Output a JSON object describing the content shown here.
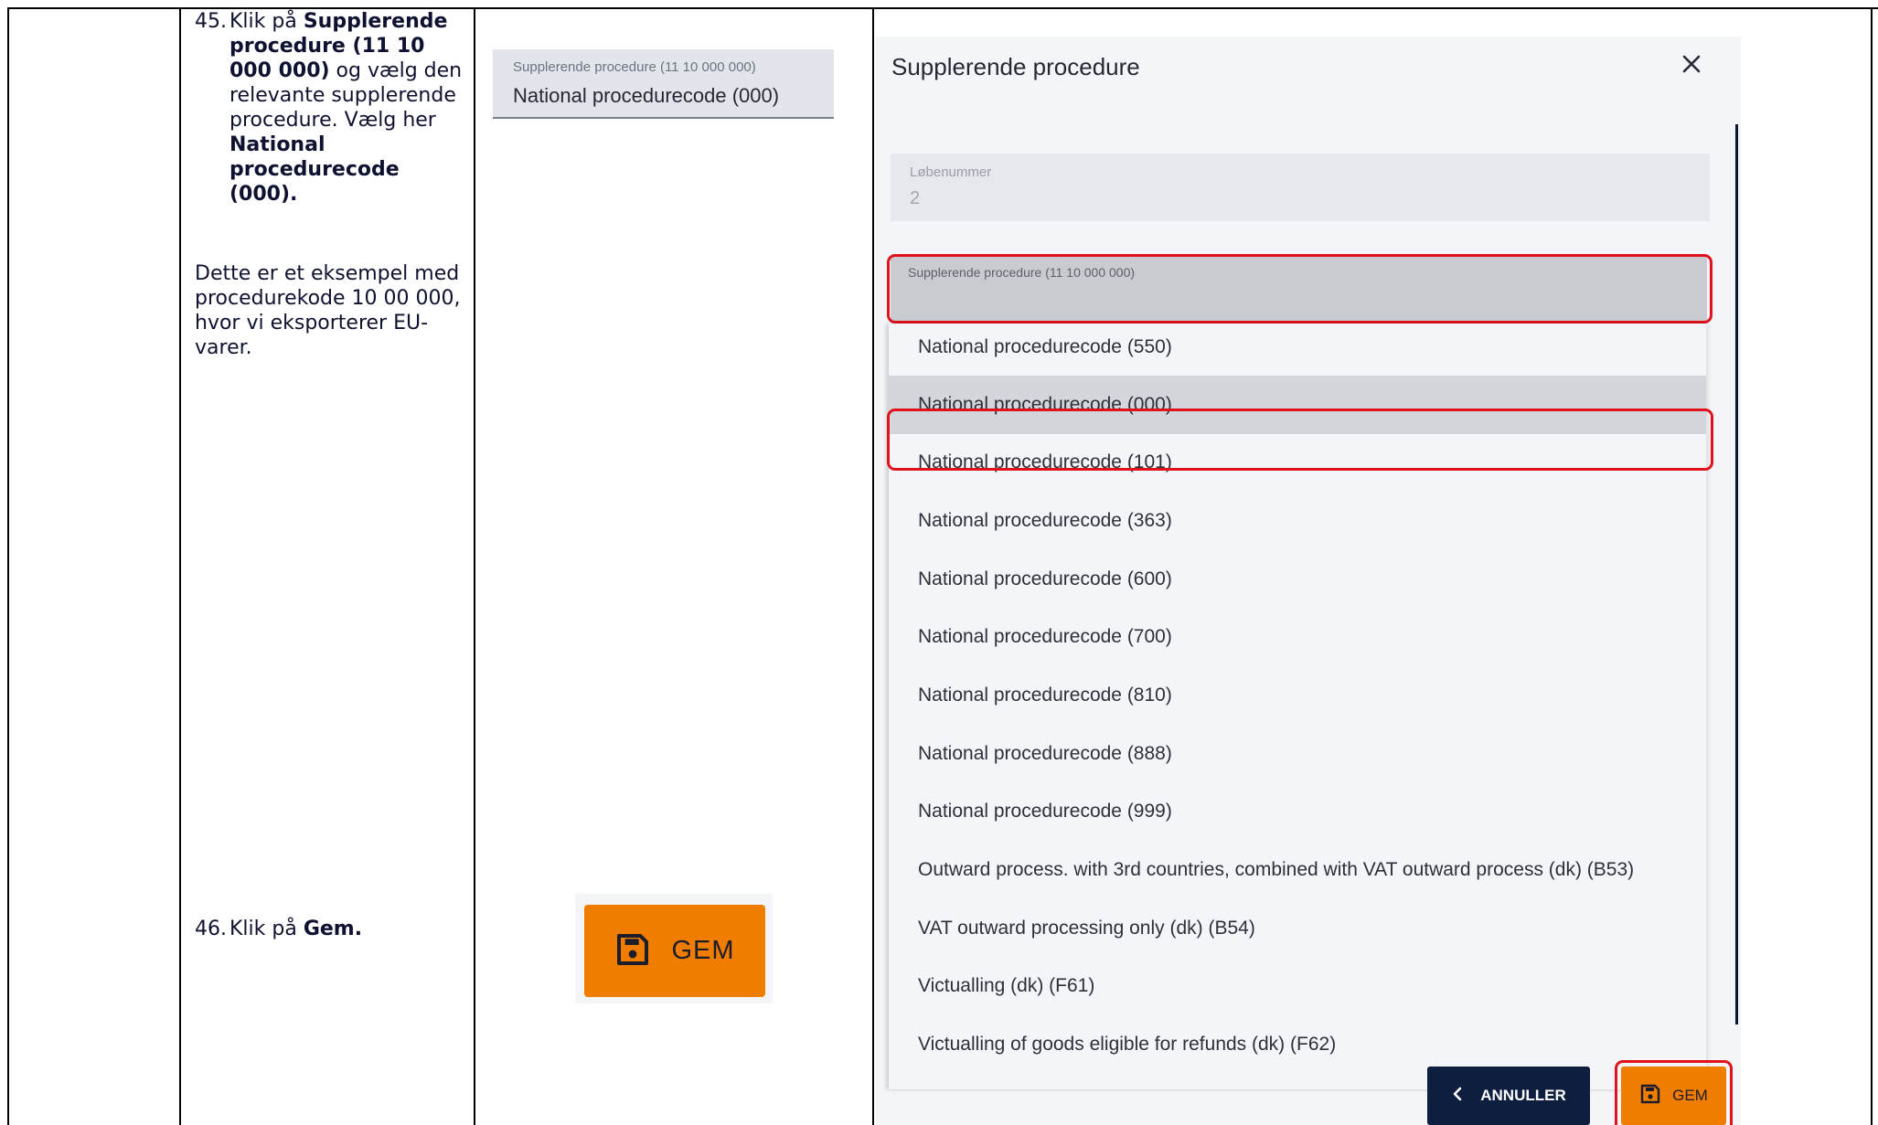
{
  "steps": [
    {
      "number": "45.",
      "lead": "Klik på ",
      "bold1": "Supplerende procedure (11 10 000 000)",
      "mid": " og vælg den relevante supplerende procedure. Vælg her ",
      "bold2": "National procedurecode (000)."
    },
    {
      "number": "46.",
      "lead": "Klik på ",
      "bold1": "Gem."
    }
  ],
  "note": "Dette er et eksempel med procedurekode 10 00 000, hvor vi eksporterer EU-varer.",
  "snippet_field": {
    "label": "Supplerende procedure (11 10 000 000)",
    "value": "National procedurecode (000)"
  },
  "snippet_button": {
    "label": "GEM",
    "icon": "save-icon"
  },
  "dialog": {
    "title": "Supplerende procedure",
    "close_icon": "close-icon",
    "lobenummer": {
      "label": "Løbenummer",
      "value": "2"
    },
    "procedure_field": {
      "label": "Supplerende procedure (11 10 000 000)"
    },
    "options": [
      "National procedurecode (550)",
      "National procedurecode (000)",
      "National procedurecode (101)",
      "National procedurecode (363)",
      "National procedurecode (600)",
      "National procedurecode (700)",
      "National procedurecode (810)",
      "National procedurecode (888)",
      "National procedurecode (999)",
      "Outward process. with 3rd countries, combined with VAT outward process (dk) (B53)",
      "VAT outward processing only (dk) (B54)",
      "Victualling (dk) (F61)",
      "Victualling of goods eligible for refunds (dk) (F62)"
    ],
    "selected_option": "National procedurecode (000)",
    "cancel_label": "ANNULLER",
    "save_label": "GEM"
  },
  "colors": {
    "highlight": "#e0121b",
    "primary_orange": "#f07c00",
    "navy": "#0d1e3f",
    "text_dark": "#0e1230"
  }
}
